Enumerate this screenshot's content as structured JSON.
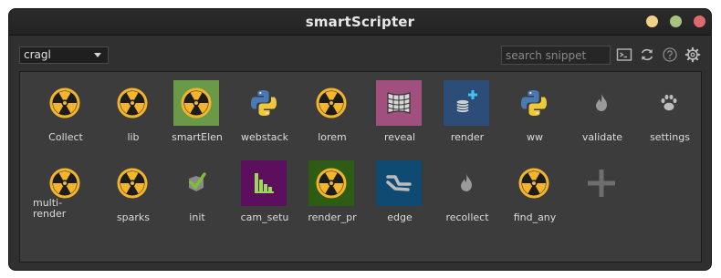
{
  "window": {
    "title": "smartScripter",
    "controls": {
      "minimize_color": "#f1d188",
      "maximize_color": "#a8c27f",
      "close_color": "#dd6b6d"
    }
  },
  "toolbar": {
    "repo_select": {
      "value": "cragl"
    },
    "search": {
      "placeholder": "search snippet",
      "value": ""
    },
    "icons": [
      "terminal-icon",
      "refresh-icon",
      "help-icon",
      "gear-icon"
    ]
  },
  "grid": {
    "rows": [
      [
        {
          "label": "Collect",
          "icon": "nuke-icon"
        },
        {
          "label": "lib",
          "icon": "nuke-icon"
        },
        {
          "label": "smartElen",
          "icon": "nuke-icon",
          "bg": "#6a9a48"
        },
        {
          "label": "webstack",
          "icon": "python-icon"
        },
        {
          "label": "lorem",
          "icon": "nuke-icon"
        },
        {
          "label": "reveal",
          "icon": "grid-mesh-icon",
          "bg": "#a14f7e"
        },
        {
          "label": "render",
          "icon": "coins-plus-icon",
          "bg": "#2d4d79"
        },
        {
          "label": "ww",
          "icon": "python-icon"
        },
        {
          "label": "validate",
          "icon": "flame-icon"
        },
        {
          "label": "settings",
          "icon": "paw-icon"
        }
      ],
      [
        {
          "label": "multi-render",
          "label_lines": [
            "multi-",
            "render"
          ],
          "icon": "nuke-icon"
        },
        {
          "label": "sparks",
          "icon": "nuke-icon"
        },
        {
          "label": "init",
          "icon": "check-shield-icon"
        },
        {
          "label": "cam_setu",
          "icon": "bar-chart-icon",
          "bg": "#5c0f5c"
        },
        {
          "label": "render_pr",
          "icon": "nuke-icon",
          "bg": "#2e5c14"
        },
        {
          "label": "edge",
          "icon": "edge-icon",
          "bg": "#0f4a73"
        },
        {
          "label": "recollect",
          "icon": "flame-icon"
        },
        {
          "label": "find_any",
          "icon": "nuke-icon"
        },
        {
          "label": "",
          "icon": "plus-icon"
        }
      ]
    ]
  },
  "colors": {
    "nuke_yellow": "#f2b52c",
    "window_bg": "#303030",
    "grid_bg": "#3c3c3c"
  }
}
